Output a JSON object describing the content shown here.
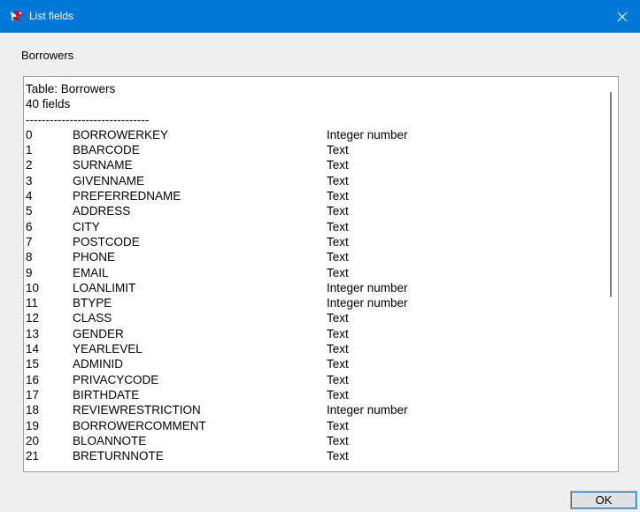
{
  "window": {
    "title": "List fields",
    "title_bar_color": "#0078d7",
    "icon": "app-bird-icon",
    "close_icon": "close-icon"
  },
  "subheader": "Borrowers",
  "panel": {
    "table_line": "Table: Borrowers",
    "count_line": "40 fields",
    "separator": "-------------------------------",
    "rows": [
      {
        "idx": "0",
        "name": "BORROWERKEY",
        "type": "Integer number"
      },
      {
        "idx": "1",
        "name": "BBARCODE",
        "type": "Text"
      },
      {
        "idx": "2",
        "name": "SURNAME",
        "type": "Text"
      },
      {
        "idx": "3",
        "name": "GIVENNAME",
        "type": "Text"
      },
      {
        "idx": "4",
        "name": "PREFERREDNAME",
        "type": "Text"
      },
      {
        "idx": "5",
        "name": "ADDRESS",
        "type": "Text"
      },
      {
        "idx": "6",
        "name": "CITY",
        "type": "Text"
      },
      {
        "idx": "7",
        "name": "POSTCODE",
        "type": "Text"
      },
      {
        "idx": "8",
        "name": "PHONE",
        "type": "Text"
      },
      {
        "idx": "9",
        "name": "EMAIL",
        "type": "Text"
      },
      {
        "idx": "10",
        "name": "LOANLIMIT",
        "type": "Integer number"
      },
      {
        "idx": "11",
        "name": "BTYPE",
        "type": "Integer number"
      },
      {
        "idx": "12",
        "name": "CLASS",
        "type": "Text"
      },
      {
        "idx": "13",
        "name": "GENDER",
        "type": "Text"
      },
      {
        "idx": "14",
        "name": "YEARLEVEL",
        "type": "Text"
      },
      {
        "idx": "15",
        "name": "ADMINID",
        "type": "Text"
      },
      {
        "idx": "16",
        "name": "PRIVACYCODE",
        "type": "Text"
      },
      {
        "idx": "17",
        "name": "BIRTHDATE",
        "type": "Text"
      },
      {
        "idx": "18",
        "name": "REVIEWRESTRICTION",
        "type": "Integer number"
      },
      {
        "idx": "19",
        "name": "BORROWERCOMMENT",
        "type": "Text"
      },
      {
        "idx": "20",
        "name": "BLOANNOTE",
        "type": "Text"
      },
      {
        "idx": "21",
        "name": "BRETURNNOTE",
        "type": "Text"
      }
    ]
  },
  "buttons": {
    "ok_label": "OK"
  }
}
